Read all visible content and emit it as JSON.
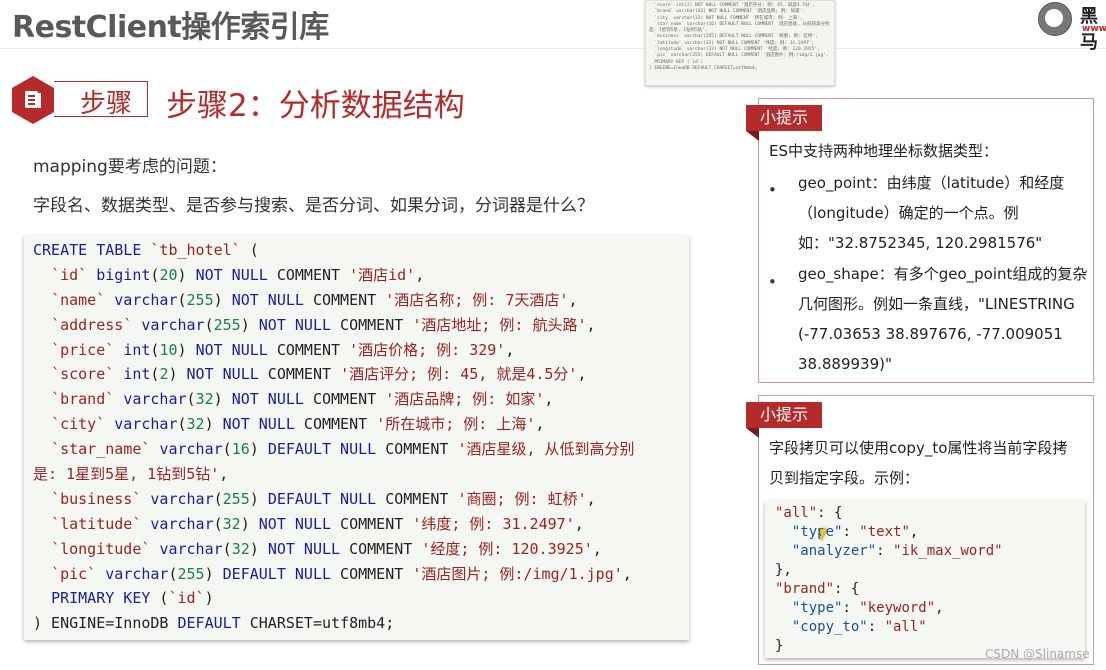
{
  "header": {
    "title": "RestClient操作索引库",
    "logo_text": "黑马",
    "logo_url": "www."
  },
  "step": {
    "badge_label": "步骤",
    "heading": "步骤2：分析数据结构"
  },
  "intro": {
    "line1": "mapping要考虑的问题：",
    "line2": "字段名、数据类型、是否参与搜索、是否分词、如果分词，分词器是什么？"
  },
  "thumbnail": {
    "lines": [
      "  `score` int(2) NOT NULL COMMENT '酒店评分; 例: 45, 就是4.5分',",
      "  `brand` varchar(32) NOT NULL COMMENT '酒店品牌; 例: 如家',",
      "  `city` varchar(32) NOT NULL COMMENT '所在城市; 例: 上海',",
      "  `star_name` varchar(16) DEFAULT NULL COMMENT '酒店星级, 从低到高分别",
      "是: 1星到5星, 1钻到5钻',",
      "  `business` varchar(255) DEFAULT NULL COMMENT '商圈; 例: 虹桥',",
      "  `latitude` varchar(32) NOT NULL COMMENT '纬度; 例: 31.2497',",
      "  `longitude` varchar(32) NOT NULL COMMENT '经度; 例: 120.3925',",
      "  `pic` varchar(255) DEFAULT NULL COMMENT '酒店图片; 例:/img/1.jpg',",
      "  PRIMARY KEY (`id`)",
      ") ENGINE=InnoDB DEFAULT CHARSET=utf8mb4;"
    ]
  },
  "sql_code": {
    "lines": [
      [
        [
          "kw",
          "CREATE TABLE "
        ],
        [
          "id",
          "`tb_hotel`"
        ],
        [
          "plain",
          " ("
        ]
      ],
      [
        [
          "plain",
          "  "
        ],
        [
          "id",
          "`id`"
        ],
        [
          "plain",
          " "
        ],
        [
          "kw",
          "bigint"
        ],
        [
          "plain",
          "("
        ],
        [
          "num",
          "20"
        ],
        [
          "plain",
          ") "
        ],
        [
          "kw",
          "NOT NULL"
        ],
        [
          "plain",
          " COMMENT "
        ],
        [
          "str",
          "'酒店id'"
        ],
        [
          "plain",
          ","
        ]
      ],
      [
        [
          "plain",
          "  "
        ],
        [
          "id",
          "`name`"
        ],
        [
          "plain",
          " "
        ],
        [
          "kw",
          "varchar"
        ],
        [
          "plain",
          "("
        ],
        [
          "num",
          "255"
        ],
        [
          "plain",
          ") "
        ],
        [
          "kw",
          "NOT NULL"
        ],
        [
          "plain",
          " COMMENT "
        ],
        [
          "str",
          "'酒店名称; 例: 7天酒店'"
        ],
        [
          "plain",
          ","
        ]
      ],
      [
        [
          "plain",
          "  "
        ],
        [
          "id",
          "`address`"
        ],
        [
          "plain",
          " "
        ],
        [
          "kw",
          "varchar"
        ],
        [
          "plain",
          "("
        ],
        [
          "num",
          "255"
        ],
        [
          "plain",
          ") "
        ],
        [
          "kw",
          "NOT NULL"
        ],
        [
          "plain",
          " COMMENT "
        ],
        [
          "str",
          "'酒店地址; 例: 航头路'"
        ],
        [
          "plain",
          ","
        ]
      ],
      [
        [
          "plain",
          "  "
        ],
        [
          "id",
          "`price`"
        ],
        [
          "plain",
          " "
        ],
        [
          "kw",
          "int"
        ],
        [
          "plain",
          "("
        ],
        [
          "num",
          "10"
        ],
        [
          "plain",
          ") "
        ],
        [
          "kw",
          "NOT NULL"
        ],
        [
          "plain",
          " COMMENT "
        ],
        [
          "str",
          "'酒店价格; 例: 329'"
        ],
        [
          "plain",
          ","
        ]
      ],
      [
        [
          "plain",
          "  "
        ],
        [
          "id",
          "`score`"
        ],
        [
          "plain",
          " "
        ],
        [
          "kw",
          "int"
        ],
        [
          "plain",
          "("
        ],
        [
          "num",
          "2"
        ],
        [
          "plain",
          ") "
        ],
        [
          "kw",
          "NOT NULL"
        ],
        [
          "plain",
          " COMMENT "
        ],
        [
          "str",
          "'酒店评分; 例: 45, 就是4.5分'"
        ],
        [
          "plain",
          ","
        ]
      ],
      [
        [
          "plain",
          "  "
        ],
        [
          "id",
          "`brand`"
        ],
        [
          "plain",
          " "
        ],
        [
          "kw",
          "varchar"
        ],
        [
          "plain",
          "("
        ],
        [
          "num",
          "32"
        ],
        [
          "plain",
          ") "
        ],
        [
          "kw",
          "NOT NULL"
        ],
        [
          "plain",
          " COMMENT "
        ],
        [
          "str",
          "'酒店品牌; 例: 如家'"
        ],
        [
          "plain",
          ","
        ]
      ],
      [
        [
          "plain",
          "  "
        ],
        [
          "id",
          "`city`"
        ],
        [
          "plain",
          " "
        ],
        [
          "kw",
          "varchar"
        ],
        [
          "plain",
          "("
        ],
        [
          "num",
          "32"
        ],
        [
          "plain",
          ") "
        ],
        [
          "kw",
          "NOT NULL"
        ],
        [
          "plain",
          " COMMENT "
        ],
        [
          "str",
          "'所在城市; 例: 上海'"
        ],
        [
          "plain",
          ","
        ]
      ],
      [
        [
          "plain",
          "  "
        ],
        [
          "id",
          "`star_name`"
        ],
        [
          "plain",
          " "
        ],
        [
          "kw",
          "varchar"
        ],
        [
          "plain",
          "("
        ],
        [
          "num",
          "16"
        ],
        [
          "plain",
          ") "
        ],
        [
          "kw",
          "DEFAULT NULL"
        ],
        [
          "plain",
          " COMMENT "
        ],
        [
          "str",
          "'酒店星级, 从低到高分别"
        ]
      ],
      [
        [
          "str",
          "是: 1星到5星, 1钻到5钻'"
        ],
        [
          "plain",
          ","
        ]
      ],
      [
        [
          "plain",
          "  "
        ],
        [
          "id",
          "`business`"
        ],
        [
          "plain",
          " "
        ],
        [
          "kw",
          "varchar"
        ],
        [
          "plain",
          "("
        ],
        [
          "num",
          "255"
        ],
        [
          "plain",
          ") "
        ],
        [
          "kw",
          "DEFAULT NULL"
        ],
        [
          "plain",
          " COMMENT "
        ],
        [
          "str",
          "'商圈; 例: 虹桥'"
        ],
        [
          "plain",
          ","
        ]
      ],
      [
        [
          "plain",
          "  "
        ],
        [
          "id",
          "`latitude`"
        ],
        [
          "plain",
          " "
        ],
        [
          "kw",
          "varchar"
        ],
        [
          "plain",
          "("
        ],
        [
          "num",
          "32"
        ],
        [
          "plain",
          ") "
        ],
        [
          "kw",
          "NOT NULL"
        ],
        [
          "plain",
          " COMMENT "
        ],
        [
          "str",
          "'纬度; 例: 31.2497'"
        ],
        [
          "plain",
          ","
        ]
      ],
      [
        [
          "plain",
          "  "
        ],
        [
          "id",
          "`longitude`"
        ],
        [
          "plain",
          " "
        ],
        [
          "kw",
          "varchar"
        ],
        [
          "plain",
          "("
        ],
        [
          "num",
          "32"
        ],
        [
          "plain",
          ") "
        ],
        [
          "kw",
          "NOT NULL"
        ],
        [
          "plain",
          " COMMENT "
        ],
        [
          "str",
          "'经度; 例: 120.3925'"
        ],
        [
          "plain",
          ","
        ]
      ],
      [
        [
          "plain",
          "  "
        ],
        [
          "id",
          "`pic`"
        ],
        [
          "plain",
          " "
        ],
        [
          "kw",
          "varchar"
        ],
        [
          "plain",
          "("
        ],
        [
          "num",
          "255"
        ],
        [
          "plain",
          ") "
        ],
        [
          "kw",
          "DEFAULT NULL"
        ],
        [
          "plain",
          " COMMENT "
        ],
        [
          "str",
          "'酒店图片; 例:/img/1.jpg'"
        ],
        [
          "plain",
          ","
        ]
      ],
      [
        [
          "plain",
          "  "
        ],
        [
          "kw",
          "PRIMARY KEY"
        ],
        [
          "plain",
          " ("
        ],
        [
          "id",
          "`id`"
        ],
        [
          "plain",
          ")"
        ]
      ],
      [
        [
          "plain",
          ") ENGINE=InnoDB "
        ],
        [
          "kw",
          "DEFAULT"
        ],
        [
          "plain",
          " CHARSET=utf8mb4;"
        ]
      ]
    ]
  },
  "tip1": {
    "tag": "小提示",
    "intro": "ES中支持两种地理坐标数据类型：",
    "bullets": [
      {
        "symbol": "•",
        "text": "geo_point：由纬度（latitude）和经度（longitude）确定的一个点。例如：\"32.8752345, 120.2981576\""
      },
      {
        "symbol": "•",
        "text": "geo_shape：有多个geo_point组成的复杂几何图形。例如一条直线，\"LINESTRING (-77.03653 38.897676, -77.009051 38.889939)\""
      }
    ]
  },
  "tip2": {
    "tag": "小提示",
    "text_line1": "字段拷贝可以使用copy_to属性将当前字段拷",
    "text_line2": "贝到指定字段。示例：",
    "json_lines": [
      [
        [
          "jkeytop",
          "\"all\""
        ],
        [
          "jp",
          ": {"
        ]
      ],
      [
        [
          "jp",
          "  "
        ],
        [
          "jkey",
          "\"type\""
        ],
        [
          "jp",
          ": "
        ],
        [
          "jstr",
          "\"text\""
        ],
        [
          "jp",
          ","
        ]
      ],
      [
        [
          "jp",
          "  "
        ],
        [
          "jkey",
          "\"analyzer\""
        ],
        [
          "jp",
          ": "
        ],
        [
          "jstr",
          "\"ik_max_word\""
        ]
      ],
      [
        [
          "jp",
          "},"
        ]
      ],
      [
        [
          "jkeytop",
          "\"brand\""
        ],
        [
          "jp",
          ": {"
        ]
      ],
      [
        [
          "jp",
          "  "
        ],
        [
          "jkey",
          "\"type\""
        ],
        [
          "jp",
          ": "
        ],
        [
          "jstr",
          "\"keyword\""
        ],
        [
          "jp",
          ","
        ]
      ],
      [
        [
          "jp",
          "  "
        ],
        [
          "jkey",
          "\"copy_to\""
        ],
        [
          "jp",
          ": "
        ],
        [
          "jstr",
          "\"all\""
        ]
      ],
      [
        [
          "jp",
          "}"
        ]
      ]
    ]
  },
  "watermark": "CSDN @Slinamse",
  "colors": {
    "accent": "#b52a2a",
    "keyword": "#1a1aa8",
    "identifier": "#9b2222",
    "number": "#1a7d4a",
    "code_bg": "#f5f8f2"
  }
}
